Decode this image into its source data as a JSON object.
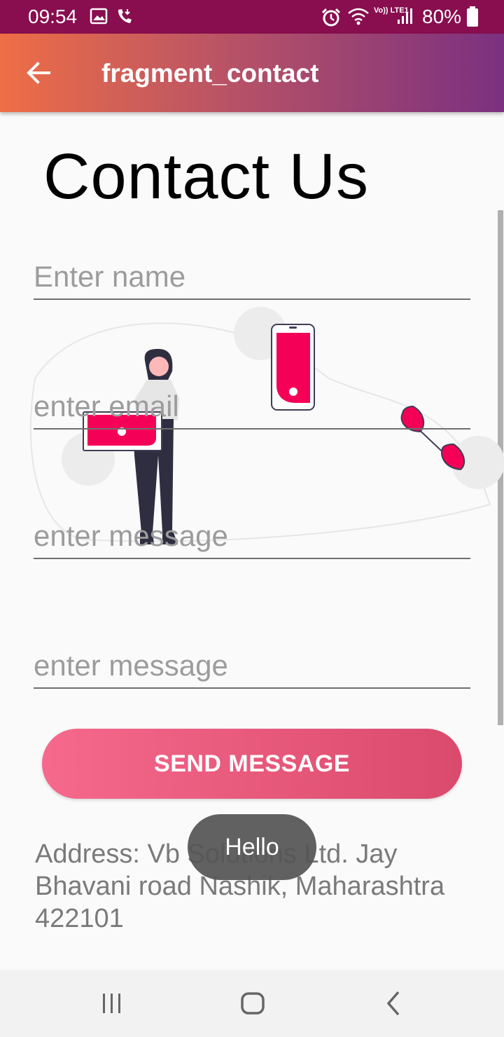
{
  "status_bar": {
    "time": "09:54",
    "network_label": "Vo)) LTE1",
    "battery": "80%"
  },
  "app_bar": {
    "title": "fragment_contact",
    "back_icon": "arrow-left-icon"
  },
  "page": {
    "heading": "Contact Us"
  },
  "form": {
    "name_placeholder": "Enter name",
    "email_placeholder": "enter email",
    "message_placeholder": "enter message",
    "message2_placeholder": "enter message",
    "send_label": "SEND MESSAGE"
  },
  "address": "Address: Vb Solutions Ltd. Jay Bhavani road Nashik, Maharashtra 422101",
  "toast": "Hello",
  "colors": {
    "status_bar": "#880e4f",
    "accent": "#f50057",
    "button_start": "#f6698c",
    "button_end": "#da4a6c"
  }
}
